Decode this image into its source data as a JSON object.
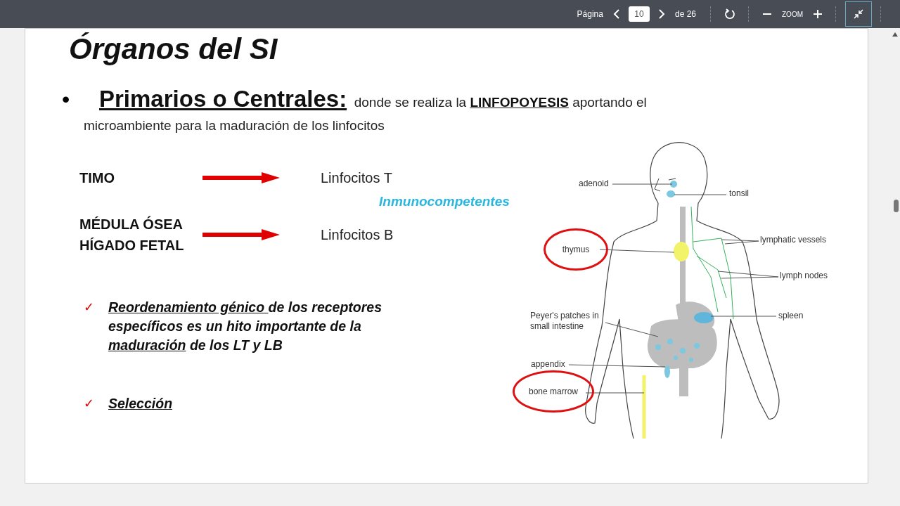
{
  "toolbar": {
    "page_label": "Página",
    "page_value": "10",
    "page_total": "de 26",
    "zoom_label": "ZOOM"
  },
  "slide": {
    "title": "Órganos del SI",
    "bullet": {
      "marker": "•",
      "lines": [
        [
          {
            "text": "Primarios o Centrales:",
            "kind": "heading"
          },
          {
            "text": "  donde se realiza la ",
            "kind": "plain"
          },
          {
            "text": "LINFOPOYESIS",
            "kind": "emphasis"
          },
          {
            "text": " aportando el",
            "kind": "plain"
          }
        ],
        [
          {
            "text": "microambiente para la maduración de los linfocitos",
            "kind": "plain"
          }
        ]
      ]
    },
    "organs": [
      {
        "name_lines": [
          "TIMO"
        ],
        "result": "Linfocitos T"
      },
      {
        "name_lines": [
          "MÉDULA ÓSEA",
          "HÍGADO FETAL"
        ],
        "result": "Linfocitos B"
      }
    ],
    "note": "Inmunocompetentes",
    "checks": [
      {
        "marker": "✓",
        "lines": [
          [
            {
              "text": "Reordenamiento génico ",
              "underline": true
            },
            {
              "text": "de los receptores",
              "underline": false
            }
          ],
          [
            {
              "text": "específicos es un hito importante de la",
              "underline": false
            }
          ],
          [
            {
              "text": "maduración",
              "underline": true
            },
            {
              "text": " de los LT y LB",
              "underline": false
            }
          ]
        ]
      },
      {
        "marker": "✓",
        "lines": [
          [
            {
              "text": "Selección",
              "underline": true
            }
          ]
        ]
      }
    ],
    "diagram": {
      "labels": [
        {
          "lines": [
            "adenoid"
          ],
          "circled": false
        },
        {
          "lines": [
            "tonsil"
          ],
          "circled": false
        },
        {
          "lines": [
            "thymus"
          ],
          "circled": true
        },
        {
          "lines": [
            "lymphatic vessels"
          ],
          "circled": false
        },
        {
          "lines": [
            "lymph nodes"
          ],
          "circled": false
        },
        {
          "lines": [
            "Peyer's patches in",
            "small intestine"
          ],
          "circled": false
        },
        {
          "lines": [
            "spleen"
          ],
          "circled": false
        },
        {
          "lines": [
            "appendix"
          ],
          "circled": false
        },
        {
          "lines": [
            "bone marrow"
          ],
          "circled": true
        }
      ]
    }
  }
}
